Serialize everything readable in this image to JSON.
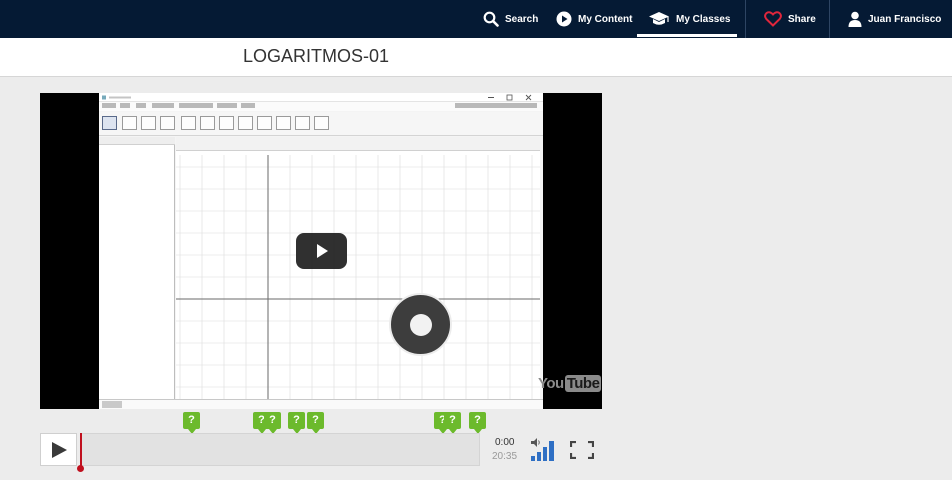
{
  "nav": {
    "search": "Search",
    "my_content": "My Content",
    "my_classes": "My Classes",
    "share": "Share",
    "user": "Juan Francisco",
    "active": "My Classes",
    "share_icon_color": "#e0263c"
  },
  "page": {
    "title": "LOGARITMOS-01"
  },
  "video": {
    "provider_text_you": "You",
    "provider_text_tube": "Tube"
  },
  "markers": [
    {
      "label": "?"
    },
    {
      "label": "?"
    },
    {
      "label": "?"
    },
    {
      "label": "?"
    },
    {
      "label": "?"
    },
    {
      "label": "?"
    },
    {
      "label": "?"
    },
    {
      "label": "?"
    }
  ],
  "player": {
    "current_time": "0:00",
    "total_time": "20:35",
    "progress_percent": 0,
    "accent_color": "#c0101e",
    "marker_color": "#6cba2c",
    "volume_color": "#2e6fc4"
  }
}
